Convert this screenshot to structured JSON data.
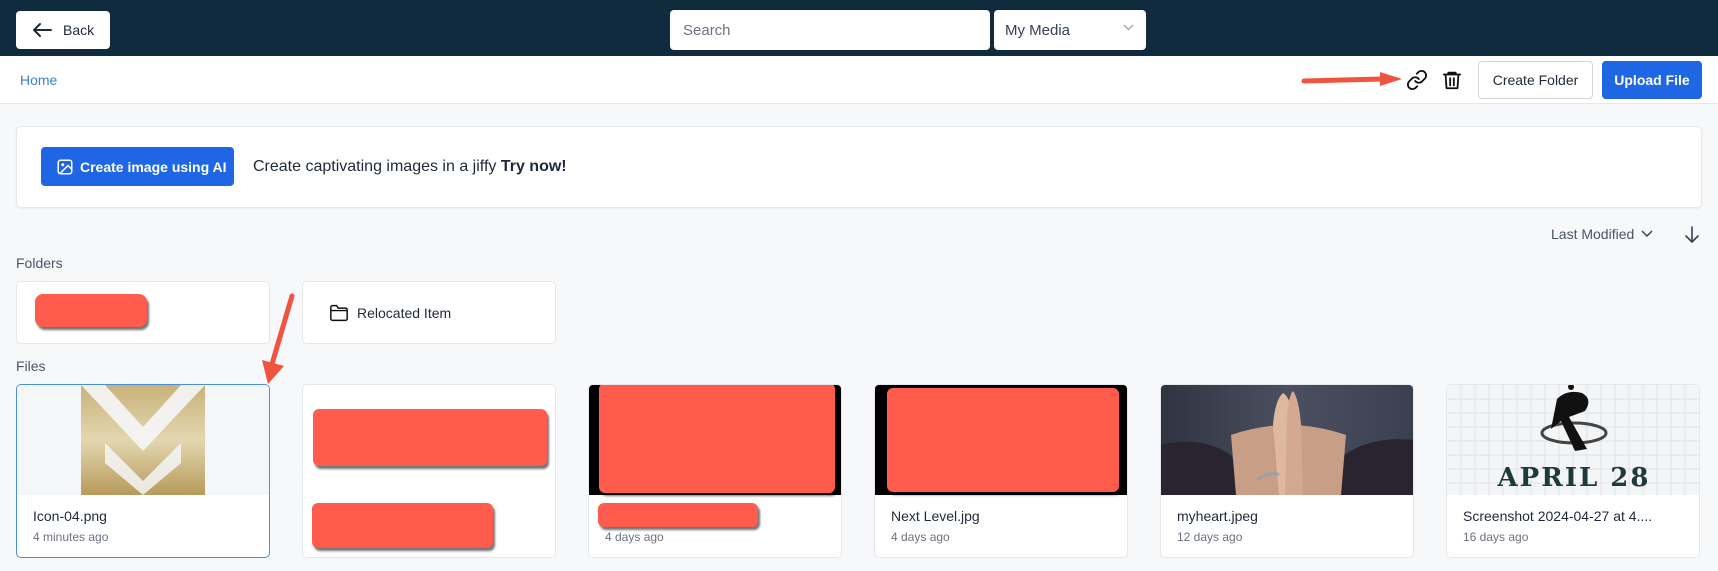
{
  "topbar": {
    "back_label": "Back",
    "search_placeholder": "Search",
    "media_select": "My Media"
  },
  "breadcrumb": {
    "home": "Home"
  },
  "actions": {
    "create_folder": "Create Folder",
    "upload_file": "Upload File"
  },
  "ai_banner": {
    "button_label": "Create image using AI",
    "text": "Create captivating images in a jiffy",
    "cta": "Try now!"
  },
  "sort": {
    "label": "Last Modified"
  },
  "sections": {
    "folders": "Folders",
    "files": "Files"
  },
  "folders": [
    {
      "name": "",
      "redacted": true
    },
    {
      "name": "Relocated Item",
      "icon": "folder-icon"
    }
  ],
  "files": [
    {
      "name": "Icon-04.png",
      "time": "4 minutes ago",
      "selected": true
    },
    {
      "name": "",
      "time": "",
      "redacted": true
    },
    {
      "name": "",
      "time": "4 days ago",
      "redacted": true
    },
    {
      "name": "Next Level.jpg",
      "time": "4 days ago"
    },
    {
      "name": "myheart.jpeg",
      "time": "12 days ago"
    },
    {
      "name": "Screenshot 2024-04-27 at 4....",
      "time": "16 days ago",
      "thumb_text": "APRIL 28"
    }
  ],
  "colors": {
    "topbar": "#0f2b3d",
    "primary": "#1f66e5",
    "link": "#3b82c4",
    "redaction": "#ff5c4d",
    "annotation_arrow": "#ef5440"
  }
}
